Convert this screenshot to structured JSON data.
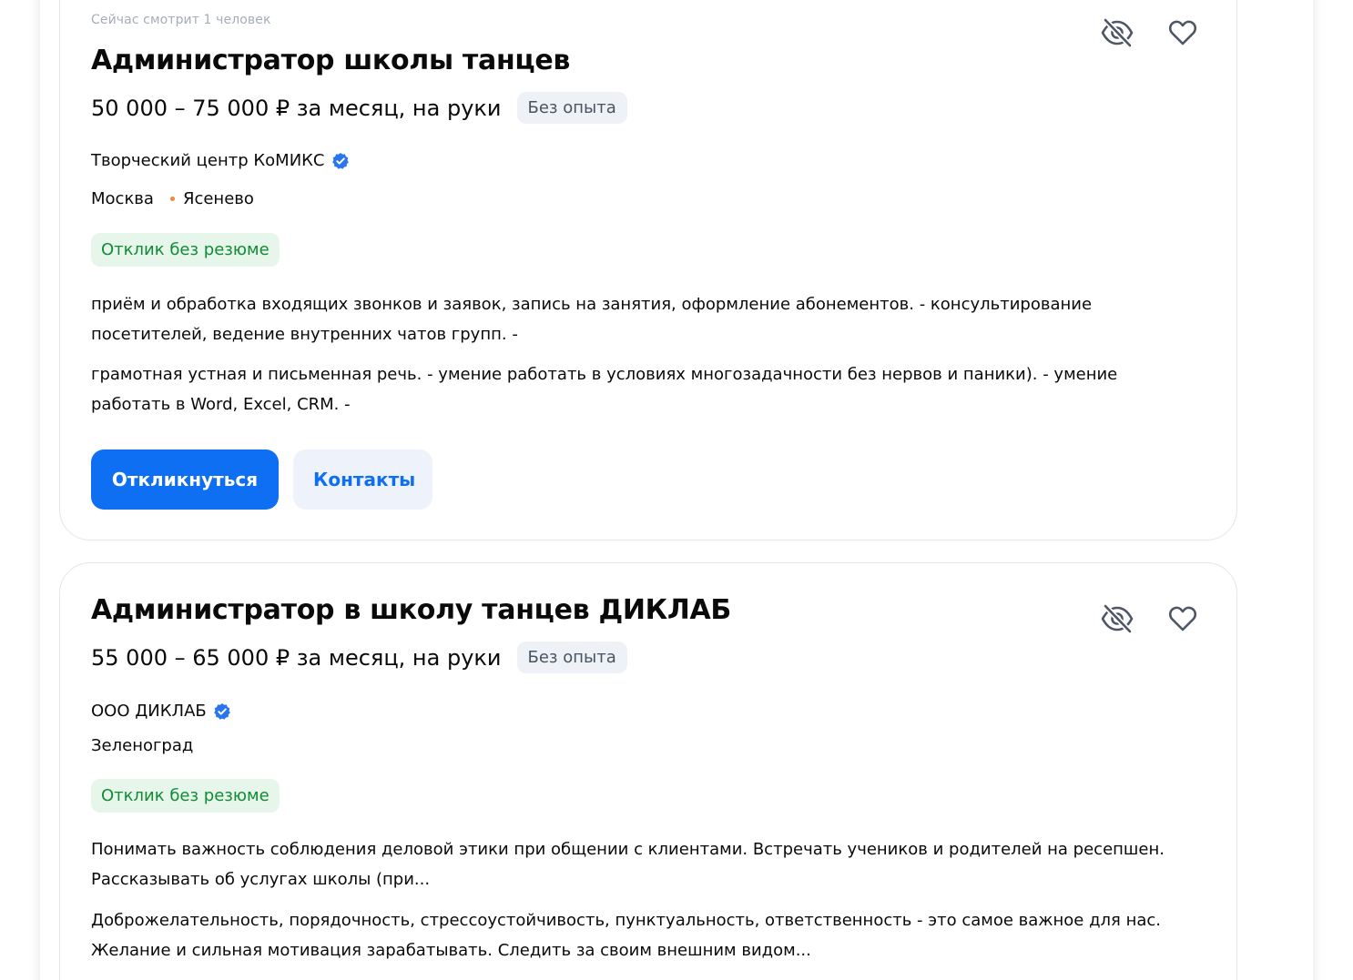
{
  "colors": {
    "accent": "#0f6ff2",
    "badge_green_text": "#138a36",
    "badge_green_bg": "#e6f6ea",
    "metro_dot": "#f0883a",
    "verified": "#2a75f0"
  },
  "vacancies": [
    {
      "watching": "Сейчас смотрит 1 человек",
      "title": "Администратор школы танцев",
      "salary": "50 000 – 75 000 ₽ за месяц, на руки",
      "experience": "Без опыта",
      "company": "Творческий центр КоМИКС",
      "company_verified": true,
      "city": "Москва",
      "metro": "Ясенево",
      "response_badge": "Отклик без резюме",
      "responsibilities": "приём и обработка входящих звонков и заявок, запись на занятия, оформление абонементов. - консультирование посетителей, ведение внутренних чатов групп. -",
      "requirements": "грамотная устная и письменная речь. - умение работать в условиях многозадачности без нервов и паники). - умение работать в Word, Excel, CRM. -",
      "apply_label": "Откликнуться",
      "contacts_label": "Контакты",
      "icons": [
        "hide-icon",
        "heart-icon",
        "verified-icon"
      ]
    },
    {
      "title": "Администратор в школу танцев ДИКЛАБ",
      "salary": "55 000 – 65 000 ₽ за месяц, на руки",
      "experience": "Без опыта",
      "company": "ООО ДИКЛАБ",
      "company_verified": true,
      "city": "Зеленоград",
      "response_badge": "Отклик без резюме",
      "responsibilities": "Понимать важность соблюдения деловой этики при общении с клиентами. Встречать учеников и родителей на ресепшен. Рассказывать об услугах школы (при...",
      "requirements": "Доброжелательность, порядочность, стрессоустойчивость, пунктуальность, ответственность - это самое важное для нас. Желание и сильная мотивация зарабатывать. Следить за своим внешним видом...",
      "icons": [
        "hide-icon",
        "heart-icon",
        "verified-icon"
      ]
    }
  ]
}
